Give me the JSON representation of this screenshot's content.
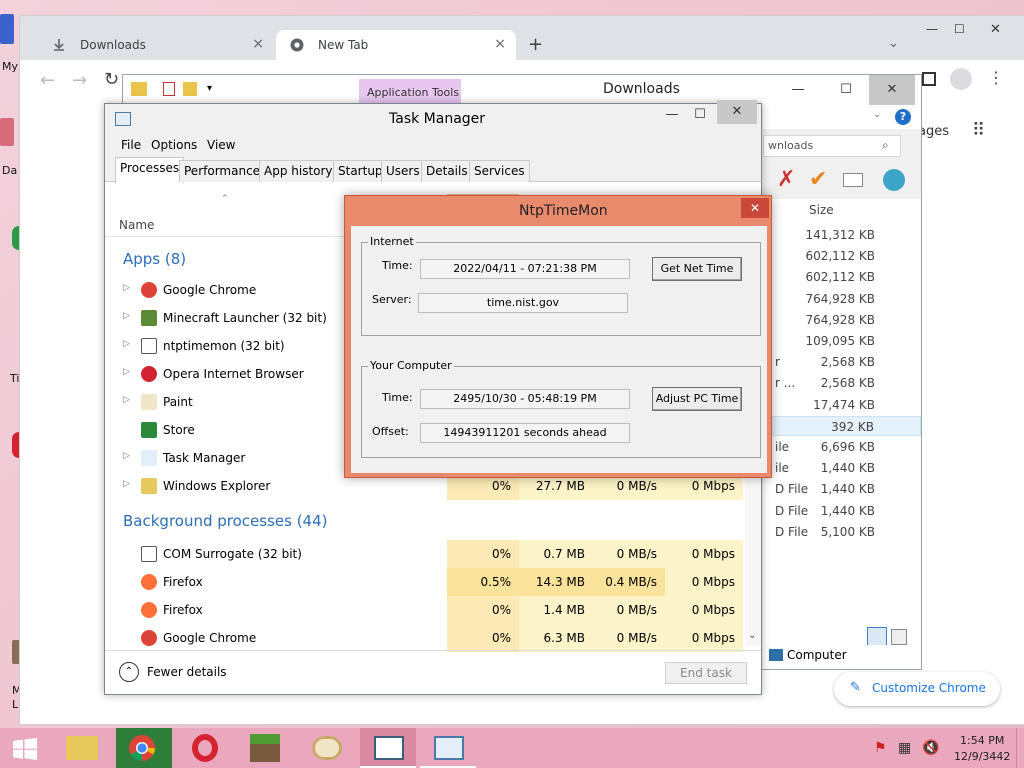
{
  "desktop": {
    "labels": [
      "My",
      "Da",
      "Ti",
      "M",
      "L"
    ]
  },
  "chrome": {
    "tabs": [
      {
        "label": "Downloads",
        "close": "×"
      },
      {
        "label": "New Tab",
        "close": "×"
      }
    ],
    "new_tab": "+",
    "apps_frag": "ages",
    "customize": "Customize Chrome",
    "window_buttons": {
      "min": "—",
      "max": "☐",
      "close": "✕"
    }
  },
  "explorer": {
    "context_tab": "Application Tools",
    "title": "Downloads",
    "search_placeholder": "wnloads",
    "size_header": "Size",
    "sizes": [
      "141,312 KB",
      "602,112 KB",
      "602,112 KB",
      "764,928 KB",
      "764,928 KB",
      "109,095 KB",
      "2,568 KB",
      "2,568 KB",
      "17,474 KB",
      "392 KB",
      "6,696 KB",
      "1,440 KB",
      "1,440 KB",
      "1,440 KB",
      "5,100 KB"
    ],
    "type_frags": [
      "",
      "",
      "",
      "",
      "",
      "",
      "r",
      "r ...",
      "",
      "",
      "ile",
      "ile",
      "D File",
      "D File",
      "D File"
    ],
    "nav_computer": "Computer"
  },
  "taskmanager": {
    "title": "Task Manager",
    "menu": [
      "File",
      "Options",
      "View"
    ],
    "tabs": [
      "Processes",
      "Performance",
      "App history",
      "Startup",
      "Users",
      "Details",
      "Services"
    ],
    "name_header": "Name",
    "apps_group": "Apps (8)",
    "apps": [
      {
        "name": "Google Chrome",
        "icon": "chrome-icon"
      },
      {
        "name": "Minecraft Launcher (32 bit)",
        "icon": "minecraft-icon"
      },
      {
        "name": "ntptimemon (32 bit)",
        "icon": "app-window-icon"
      },
      {
        "name": "Opera Internet Browser",
        "icon": "opera-icon"
      },
      {
        "name": "Paint",
        "icon": "paint-icon"
      },
      {
        "name": "Store",
        "icon": "store-icon"
      },
      {
        "name": "Task Manager",
        "icon": "task-manager-icon"
      },
      {
        "name": "Windows Explorer",
        "icon": "folder-icon",
        "cpu": "0%",
        "mem": "27.7 MB",
        "disk": "0 MB/s",
        "net": "0 Mbps"
      }
    ],
    "bg_group": "Background processes (44)",
    "bg": [
      {
        "name": "COM Surrogate (32 bit)",
        "icon": "app-window-icon",
        "cpu": "0%",
        "mem": "0.7 MB",
        "disk": "0 MB/s",
        "net": "0 Mbps"
      },
      {
        "name": "Firefox",
        "icon": "firefox-icon",
        "cpu": "0.5%",
        "mem": "14.3 MB",
        "disk": "0.4 MB/s",
        "net": "0 Mbps"
      },
      {
        "name": "Firefox",
        "icon": "firefox-icon",
        "cpu": "0%",
        "mem": "1.4 MB",
        "disk": "0 MB/s",
        "net": "0 Mbps"
      },
      {
        "name": "Google Chrome",
        "icon": "chrome-icon",
        "cpu": "0%",
        "mem": "6.3 MB",
        "disk": "0 MB/s",
        "net": "0 Mbps"
      }
    ],
    "fewer_details": "Fewer details",
    "end_task": "End task"
  },
  "ntp": {
    "title": "NtpTimeMon",
    "internet_label": "Internet",
    "time_label": "Time:",
    "internet_time": "2022/04/11 - 07:21:38 PM",
    "server_label": "Server:",
    "server": "time.nist.gov",
    "get_net_time": "Get Net Time",
    "computer_label": "Your Computer",
    "computer_time": "2495/10/30 - 05:48:19 PM",
    "offset_label": "Offset:",
    "offset": "14943911201 seconds ahead",
    "adjust_pc_time": "Adjust PC Time"
  },
  "taskbar": {
    "time": "1:54 PM",
    "date": "12/9/3442"
  },
  "colors": {
    "accent": "#2a6fb7",
    "ntp_frame": "#e98a6c",
    "heat": "#fdf3c8",
    "chrome_tab": "#dee1e6"
  }
}
